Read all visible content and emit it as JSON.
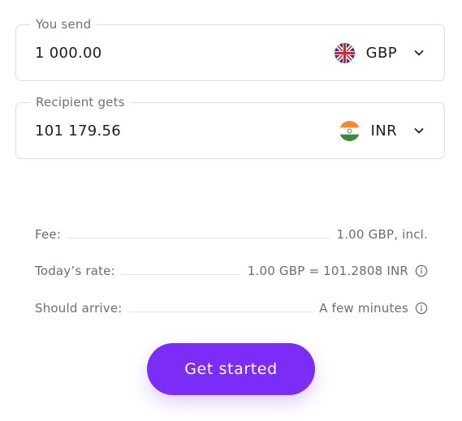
{
  "send": {
    "label": "You send",
    "amount": "1 000.00",
    "currency": "GBP",
    "flag_icon": "uk-flag-icon"
  },
  "receive": {
    "label": "Recipient gets",
    "amount": "101 179.56",
    "currency": "INR",
    "flag_icon": "india-flag-icon"
  },
  "details": {
    "fee_label": "Fee:",
    "fee_value": "1.00 GBP, incl.",
    "rate_label": "Today’s rate:",
    "rate_value": "1.00 GBP = 101.2808 INR",
    "arrive_label": "Should arrive:",
    "arrive_value": "A few minutes"
  },
  "cta": {
    "label": "Get started"
  },
  "colors": {
    "accent": "#7b2cf7",
    "border": "#dcdce3",
    "muted_text": "#6c6c75"
  }
}
